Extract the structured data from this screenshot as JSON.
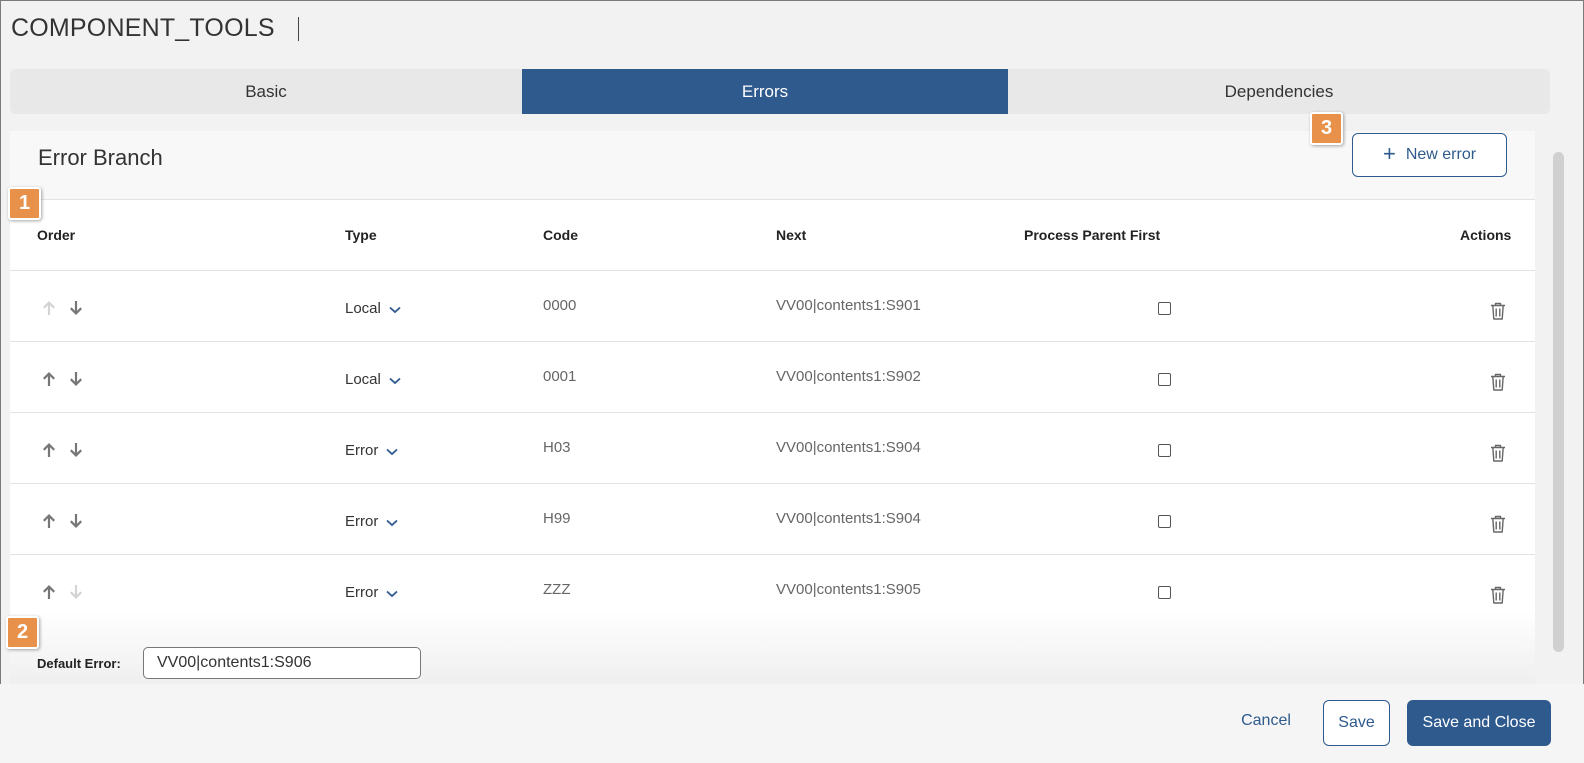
{
  "app": {
    "title": "COMPONENT_TOOLS"
  },
  "tabs": [
    {
      "label": "Basic",
      "active": false
    },
    {
      "label": "Errors",
      "active": true
    },
    {
      "label": "Dependencies",
      "active": false
    }
  ],
  "panel": {
    "title": "Error Branch",
    "new_error_label": "New error",
    "new_error_icon": "plus-icon"
  },
  "table": {
    "columns": [
      "Order",
      "Type",
      "Code",
      "Next",
      "Process Parent First",
      "Actions"
    ],
    "rows": [
      {
        "up_enabled": false,
        "down_enabled": true,
        "type": "Local",
        "code": "0000",
        "next": "VV00|contents1:S901",
        "process_parent_first": false
      },
      {
        "up_enabled": true,
        "down_enabled": true,
        "type": "Local",
        "code": "0001",
        "next": "VV00|contents1:S902",
        "process_parent_first": false
      },
      {
        "up_enabled": true,
        "down_enabled": true,
        "type": "Error",
        "code": "H03",
        "next": "VV00|contents1:S904",
        "process_parent_first": false
      },
      {
        "up_enabled": true,
        "down_enabled": true,
        "type": "Error",
        "code": "H99",
        "next": "VV00|contents1:S904",
        "process_parent_first": false
      },
      {
        "up_enabled": true,
        "down_enabled": false,
        "type": "Error",
        "code": "ZZZ",
        "next": "VV00|contents1:S905",
        "process_parent_first": false
      }
    ]
  },
  "default_error": {
    "label": "Default Error:",
    "value": "VV00|contents1:S906"
  },
  "footer": {
    "cancel_label": "Cancel",
    "save_label": "Save",
    "save_close_label": "Save and Close"
  },
  "callouts": [
    "1",
    "2",
    "3"
  ],
  "colors": {
    "accent": "#2e5a8e",
    "callout": "#e8914a",
    "arrow_enabled": "#777777",
    "arrow_disabled": "#d4d4d4"
  }
}
